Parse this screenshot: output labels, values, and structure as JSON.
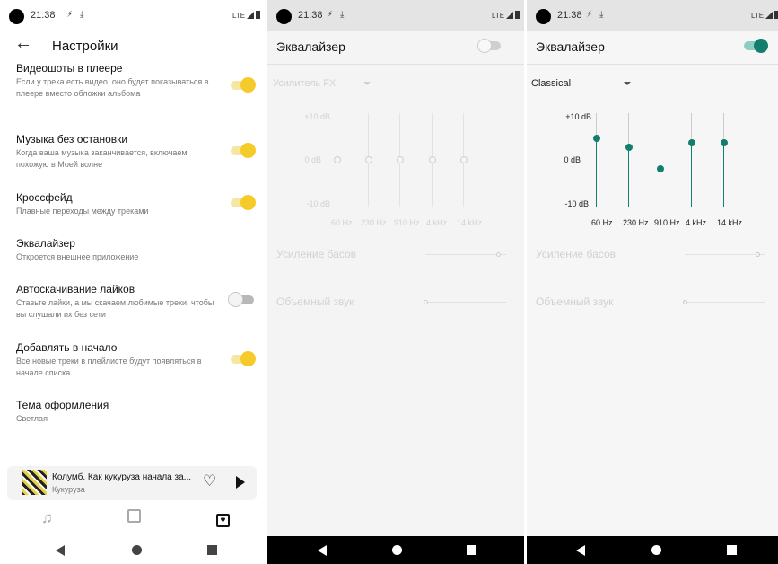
{
  "status_bar": {
    "time": "21:38",
    "network": "LTE"
  },
  "settings": {
    "title": "Настройки",
    "items": [
      {
        "title": "Видеошоты в плеере",
        "subtitle": "Если у трека есть видео, оно будет показываться в плеере вместо обложки альбома",
        "toggle": "on"
      },
      {
        "title": "Музыка без остановки",
        "subtitle": "Когда ваша музыка заканчивается, включаем похожую в Моей волне",
        "toggle": "on"
      },
      {
        "title": "Кроссфейд",
        "subtitle": "Плавные переходы между треками",
        "toggle": "on"
      },
      {
        "title": "Эквалайзер",
        "subtitle": "Откроется внешнее приложение",
        "toggle": "none"
      },
      {
        "title": "Автоскачивание лайков",
        "subtitle": "Ставьте лайки, а мы скачаем любимые треки, чтобы вы слушали их без сети",
        "toggle": "off"
      },
      {
        "title": "Добавлять в начало",
        "subtitle": "Все новые треки в плейлисте будут появляться в начале списка",
        "toggle": "on"
      },
      {
        "title": "Тема оформления",
        "subtitle": "Светлая",
        "toggle": "none"
      }
    ],
    "mini_player": {
      "title": "Колумб. Как кукуруза начала за...",
      "subtitle": "Кукуруза"
    }
  },
  "equalizer_off": {
    "title": "Эквалайзер",
    "enabled": false,
    "preset": "Усилитель FX",
    "db_labels": [
      "+10 dB",
      "0 dB",
      "-10 dB"
    ],
    "bands": [
      "60 Hz",
      "230 Hz",
      "910 Hz",
      "4 kHz",
      "14 kHz"
    ],
    "band_levels_db": [
      0,
      0,
      0,
      0,
      0
    ],
    "bass_boost_label": "Усиление басов",
    "bass_boost_level": 0.9,
    "surround_label": "Объемный звук",
    "surround_level": 0.0
  },
  "equalizer_on": {
    "title": "Эквалайзер",
    "enabled": true,
    "preset": "Classical",
    "db_labels": [
      "+10 dB",
      "0 dB",
      "-10 dB"
    ],
    "bands": [
      "60 Hz",
      "230 Hz",
      "910 Hz",
      "4 kHz",
      "14 kHz"
    ],
    "band_levels_db": [
      5,
      3,
      -2,
      4,
      4
    ],
    "bass_boost_label": "Усиление басов",
    "bass_boost_level": 0.9,
    "surround_label": "Объемный звук",
    "surround_level": 0.0
  },
  "colors": {
    "toggle_accent": "#f5cb2c",
    "eq_accent": "#137e6d"
  }
}
